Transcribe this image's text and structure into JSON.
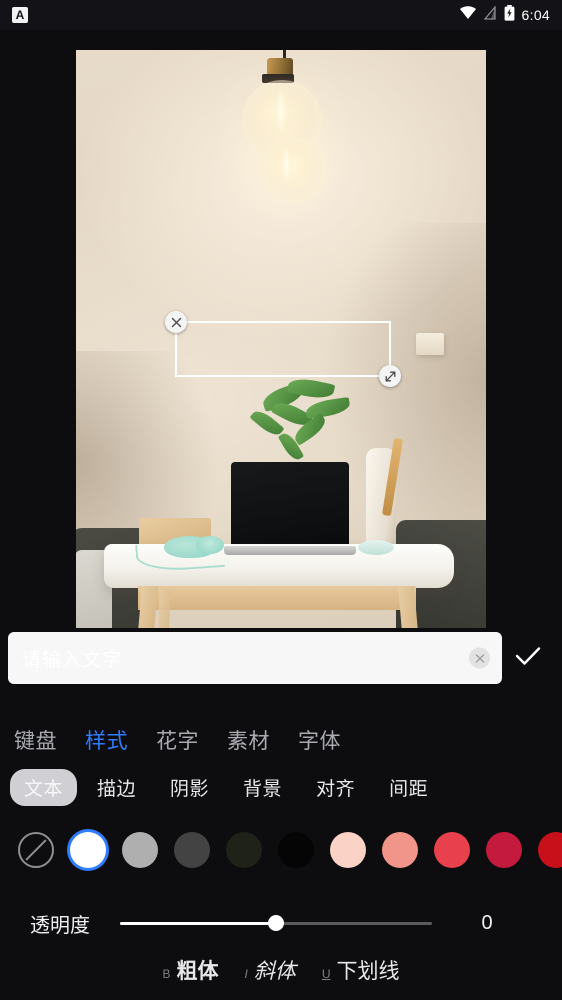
{
  "status_bar": {
    "app_icon": "A",
    "notification_icon_name": "app-notification-icon",
    "wifi_icon_name": "wifi-icon",
    "signal_icon_name": "signal-off-icon",
    "battery_icon_name": "battery-charging-icon",
    "time": "6:04"
  },
  "canvas": {
    "photo_description": "Workspace photo: pendant lamp with two glass globes over a white desk with wooden legs, laptop, headphones, plant and vase",
    "text_box": {
      "close_icon_name": "close-icon",
      "resize_icon_name": "resize-handle-icon"
    }
  },
  "input": {
    "placeholder": "请输入文字",
    "value": "",
    "clear_icon_name": "clear-circle-icon",
    "confirm_icon_name": "check-icon"
  },
  "tabs": [
    {
      "label": "键盘",
      "active": false
    },
    {
      "label": "样式",
      "active": true
    },
    {
      "label": "花字",
      "active": false
    },
    {
      "label": "素材",
      "active": false
    },
    {
      "label": "字体",
      "active": false
    }
  ],
  "subtabs": [
    {
      "label": "文本",
      "active": true
    },
    {
      "label": "描边",
      "active": false
    },
    {
      "label": "阴影",
      "active": false
    },
    {
      "label": "背景",
      "active": false
    },
    {
      "label": "对齐",
      "active": false
    },
    {
      "label": "间距",
      "active": false
    }
  ],
  "swatches": [
    {
      "name": "none",
      "color": "",
      "selected": false
    },
    {
      "name": "white",
      "color": "#FFFFFF",
      "selected": true
    },
    {
      "name": "light-gray",
      "color": "#AFAFAF",
      "selected": false
    },
    {
      "name": "dark-gray",
      "color": "#434343",
      "selected": false
    },
    {
      "name": "near-black-green",
      "color": "#1E2219",
      "selected": false
    },
    {
      "name": "black",
      "color": "#050505",
      "selected": false
    },
    {
      "name": "light-pink",
      "color": "#FBD2C6",
      "selected": false
    },
    {
      "name": "salmon",
      "color": "#F1958A",
      "selected": false
    },
    {
      "name": "red",
      "color": "#E8414D",
      "selected": false
    },
    {
      "name": "crimson",
      "color": "#C41A3D",
      "selected": false
    },
    {
      "name": "dark-red",
      "color": "#C8101B",
      "selected": false
    }
  ],
  "opacity": {
    "label": "透明度",
    "value": "0",
    "percent": 50
  },
  "text_styles": [
    {
      "mark": "B",
      "label": "粗体",
      "style": "bold"
    },
    {
      "mark": "I",
      "label": "斜体",
      "style": "italic"
    },
    {
      "mark": "U",
      "label": "下划线",
      "style": "underline"
    }
  ],
  "theme": {
    "background": "#0D0D10",
    "accent": "#2F7DFC",
    "text_primary": "#E9E9EC",
    "text_muted": "#A9ABB0"
  }
}
